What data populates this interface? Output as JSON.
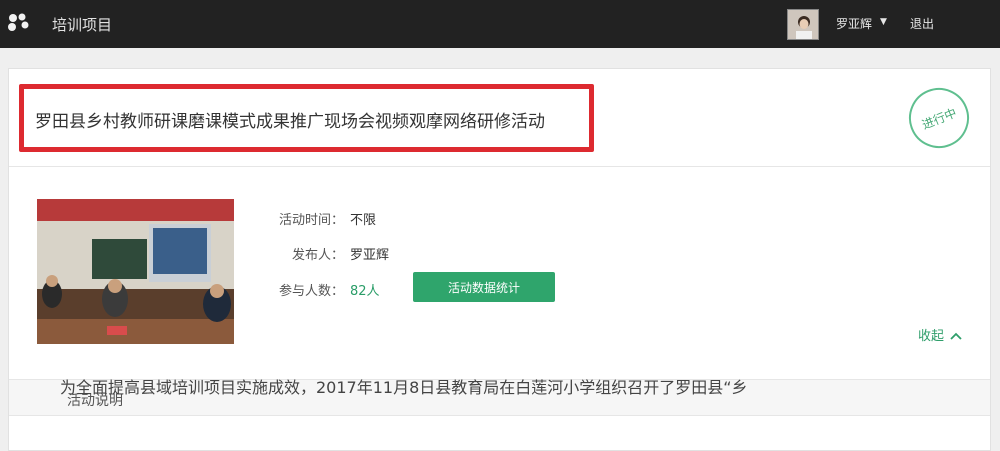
{
  "header": {
    "app_title": "培训项目",
    "user_name": "罗亚辉",
    "caret": "▼",
    "logout_label": "退出",
    "bg_color": "#222222"
  },
  "activity": {
    "title": "罗田县乡村教师研课磨课模式成果推广现场会视频观摩网络研修活动",
    "status": "进行中",
    "highlight_color": "#dd2a30"
  },
  "info": {
    "time_label": "活动时间：",
    "time_value": "不限",
    "publisher_label": "发布人：",
    "publisher_value": "罗亚辉",
    "participants_label": "参与人数：",
    "participants_value": "82人",
    "stats_button_label": "活动数据统计",
    "accent_color": "#2fa56c"
  },
  "description": {
    "section_title": "活动说明",
    "collapse_label": "收起",
    "collapse_icon": "chevron-up-icon",
    "text_partial": "为全面提高县域培训项目实施成效，2017年11月8日县教育局在白莲河小学组织召开了罗田县“乡"
  }
}
